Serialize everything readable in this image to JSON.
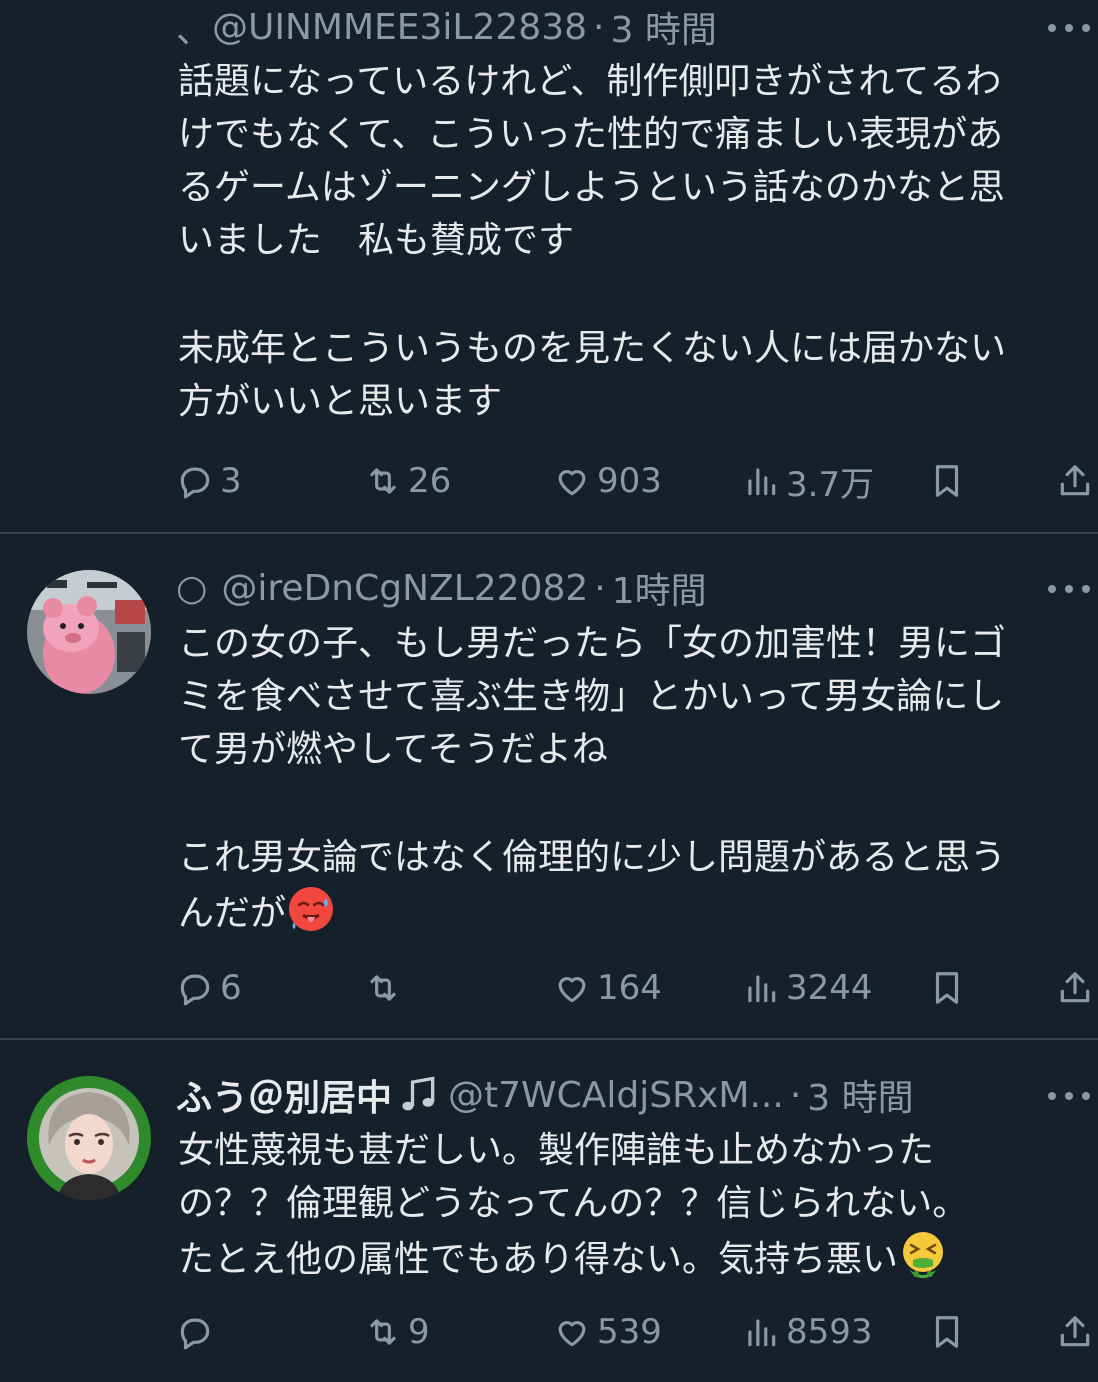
{
  "tweets": [
    {
      "name": "",
      "handle_prefix": "、",
      "handle": "@UINMMEE3iL22838",
      "time": "3 時間",
      "body_lines": [
        "話題になっているけれど、制作側叩きがされてるわ",
        "けでもなくて、こういった性的で痛ましい表現があ",
        "るゲームはゾーニングしようという話なのかなと思",
        "いました　私も賛成です",
        "",
        "未成年とこういうものを見たくない人には届かない",
        "方がいいと思います"
      ],
      "stats": {
        "replies": "3",
        "retweets": "26",
        "likes": "903",
        "views": "3.7万"
      }
    },
    {
      "name": "",
      "handle_prefix": "○",
      "handle": "@ireDnCgNZL22082",
      "time": "1時間",
      "body_lines": [
        "この女の子、もし男だったら「女の加害性！男にゴ",
        "ミを食べさせて喜ぶ生き物」とかいって男女論にし",
        "て男が燃やしてそうだよね",
        "",
        "これ男女論ではなく倫理的に少し問題があると思う",
        "んだが"
      ],
      "emoji": "hot-face-emoji",
      "stats": {
        "replies": "6",
        "retweets": "",
        "likes": "164",
        "views": "3244"
      }
    },
    {
      "name": "ふう＠別居中",
      "name_icon": "music-note-icon",
      "handle_prefix": "",
      "handle": "@t7WCAldjSRxM...",
      "time": "3 時間",
      "body_lines": [
        "女性蔑視も甚だしい。製作陣誰も止めなかった",
        "の？？倫理観どうなってんの？？信じられない。",
        "たとえ他の属性でもあり得ない。気持ち悪い"
      ],
      "emoji": "vomiting-face-emoji",
      "stats": {
        "replies": "",
        "retweets": "9",
        "likes": "539",
        "views": "8593"
      }
    }
  ],
  "colors": {
    "background": "#15202b",
    "text": "#e7e9ea",
    "muted": "#8b98a5",
    "divider": "#38444d"
  }
}
